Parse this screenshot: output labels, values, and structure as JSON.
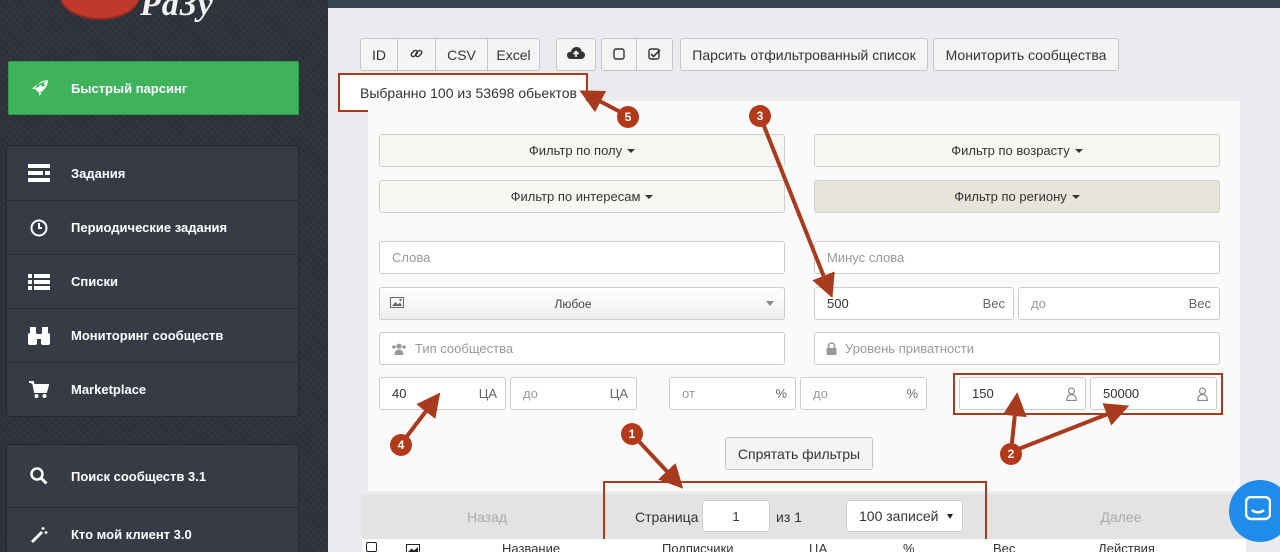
{
  "sidebar": {
    "logo_text": "Pa3y",
    "quick_parse": {
      "label": "Быстрый парсинг",
      "icon": "rocket-icon"
    },
    "group1": [
      {
        "label": "Задания",
        "icon": "tasks-icon"
      },
      {
        "label": "Периодические задания",
        "icon": "clock-icon"
      },
      {
        "label": "Списки",
        "icon": "list-icon"
      },
      {
        "label": "Мониторинг сообществ",
        "icon": "binoculars-icon"
      },
      {
        "label": "Marketplace",
        "icon": "cart-icon"
      }
    ],
    "group2": [
      {
        "label": "Поиск сообществ 3.1",
        "icon": "search-icon"
      },
      {
        "label": "Кто мой клиент 3.0",
        "icon": "magic-wand-icon"
      }
    ]
  },
  "toolbar": {
    "id": "ID",
    "link_icon": "link-icon",
    "csv": "CSV",
    "excel": "Excel",
    "upload_icon": "cloud-upload-icon",
    "uncheck_icon": "checkbox-empty-icon",
    "check_icon": "checkbox-checked-icon",
    "parse_filtered": "Парсить отфильтрованный список",
    "monitor": "Мониторить сообщества"
  },
  "selection_info": "Выбранно 100 из 53698 обьектов",
  "filters": {
    "by_gender": "Фильтр по полу",
    "by_age": "Фильтр по возрасту",
    "by_interests": "Фильтр по интересам",
    "by_region": "Фильтр по региону",
    "words_placeholder": "Слова",
    "minus_words_placeholder": "Минус слова",
    "image_select": "Любое",
    "weight_from": "500",
    "weight_suffix": "Вес",
    "weight_to_placeholder": "до",
    "community_type_placeholder": "Тип сообщества",
    "privacy_placeholder": "Уровень приватности",
    "ca_from": "40",
    "ca_suffix": "ЦА",
    "ca_to_placeholder": "до",
    "pct_from_placeholder": "от",
    "pct_suffix": "%",
    "pct_to_placeholder": "до",
    "members_from": "150",
    "members_to": "50000",
    "hide_filters": "Спрятать фильтры"
  },
  "pagination": {
    "prev": "Назад",
    "page_label": "Страница",
    "page_value": "1",
    "of_label": "из 1",
    "per_page": "100 записей",
    "next": "Далее"
  },
  "table_headers": [
    "Название",
    "Подписчики",
    "ЦА",
    "%",
    "Вес",
    "Действия"
  ],
  "annotations": [
    "1",
    "2",
    "3",
    "4",
    "5"
  ],
  "colors": {
    "quick_parse": "#3fb25c",
    "annotation": "#a83a1e",
    "chat": "#1f8ceb"
  }
}
